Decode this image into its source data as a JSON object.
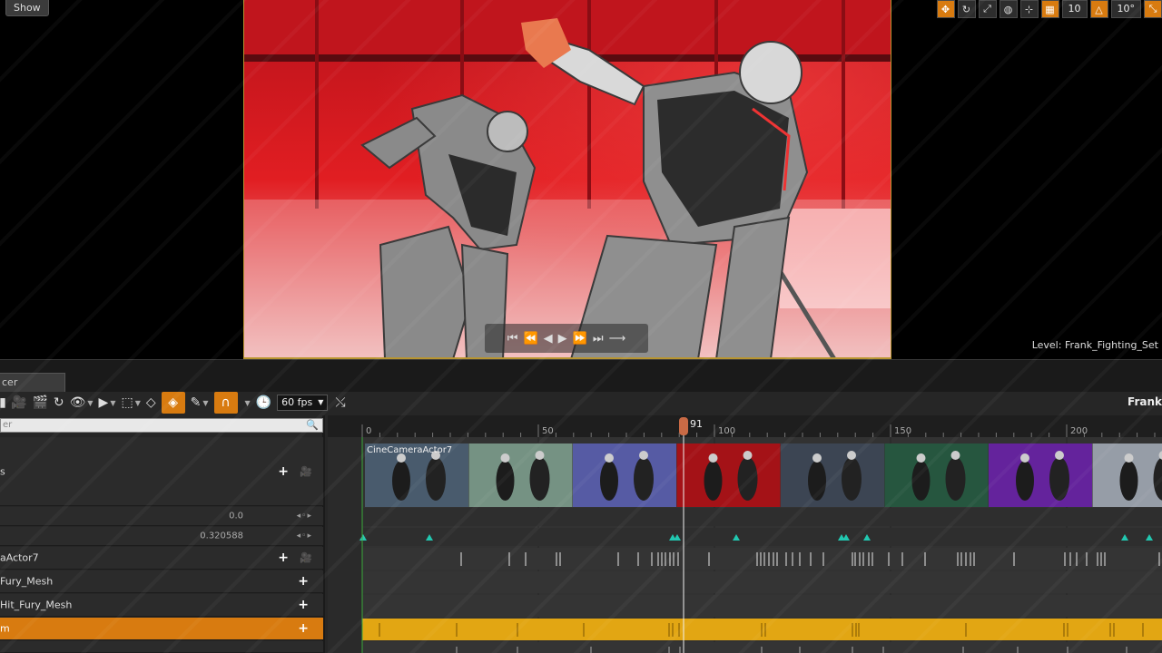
{
  "viewport": {
    "show_label": "Show",
    "grid_snap_value": "10",
    "rotation_snap_value": "10°",
    "level_label": "Level:",
    "level_name": "Frank_Fighting_Set"
  },
  "sequencer": {
    "tab_label": "cer",
    "fps": "60 fps",
    "sequence_name": "Frank",
    "search_placeholder": "er",
    "current_frame": "91",
    "ruler_labels": [
      "0",
      "50",
      "100",
      "150",
      "200"
    ],
    "camera_section_label": "CineCameraActor7",
    "tracks": [
      {
        "id": "shots",
        "label": "s",
        "add": true,
        "camera": true
      },
      {
        "id": "prop1",
        "label": "",
        "value": "0.0"
      },
      {
        "id": "prop2",
        "label": "",
        "value": "0.320588"
      },
      {
        "id": "camera",
        "label": "aActor7",
        "add": true,
        "camera": true
      },
      {
        "id": "mesh1",
        "label": "Fury_Mesh",
        "add": true
      },
      {
        "id": "mesh2",
        "label": "Hit_Fury_Mesh",
        "add": true
      },
      {
        "id": "selected",
        "label": "m",
        "add": true
      }
    ]
  },
  "colors": {
    "accent": "#d87b10",
    "selection_track": "#e2a613",
    "keyframe": "#22c7b0"
  }
}
